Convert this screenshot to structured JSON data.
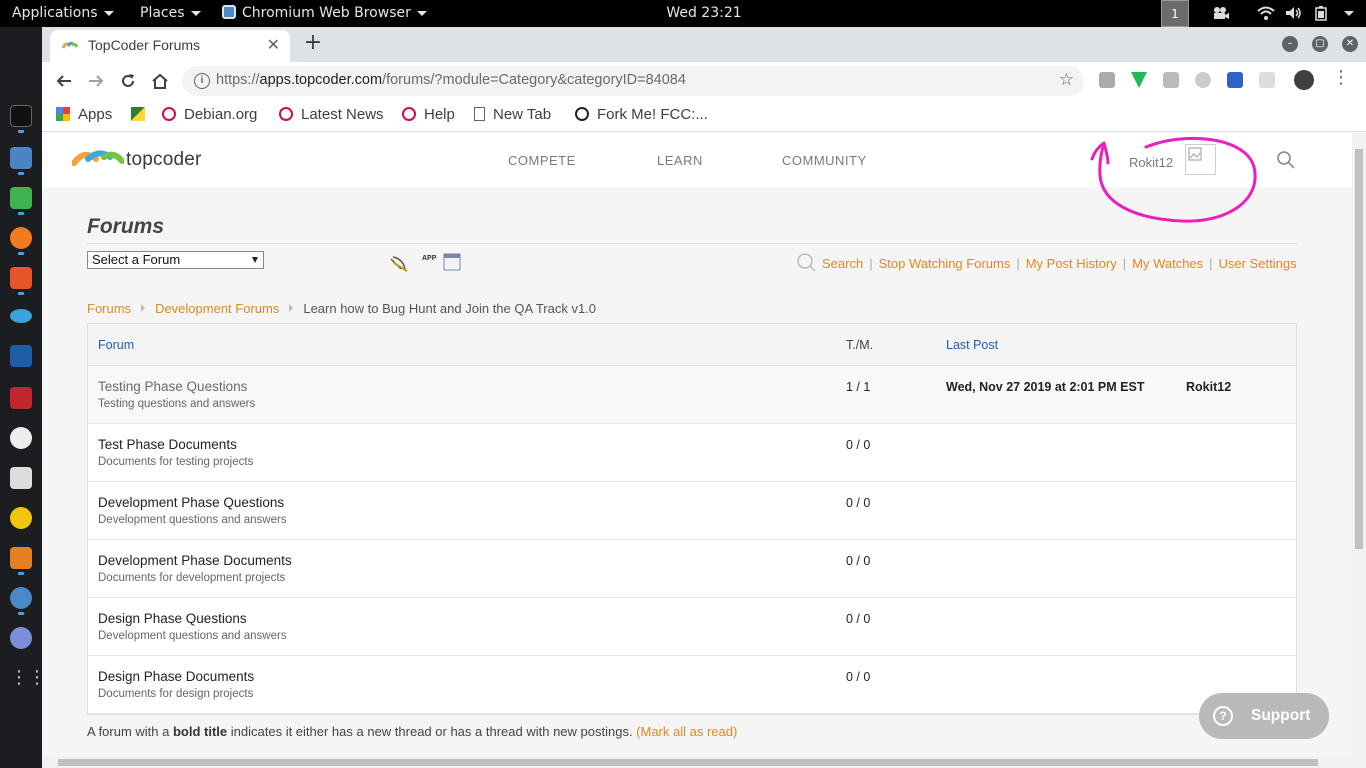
{
  "system": {
    "applications_label": "Applications",
    "places_label": "Places",
    "active_app_label": "Chromium Web Browser",
    "clock": "Wed 23:21",
    "workspace": "1"
  },
  "browser": {
    "tab_title": "TopCoder Forums",
    "url_scheme": "https://",
    "url_host": "apps.topcoder.com",
    "url_path": "/forums/?module=Category&categoryID=84084",
    "bookmarks": [
      "Apps",
      "",
      "Debian.org",
      "Latest News",
      "Help",
      "New Tab",
      "Fork Me! FCC:..."
    ]
  },
  "site": {
    "logo_text": "topcoder",
    "nav": [
      "COMPETE",
      "LEARN",
      "COMMUNITY"
    ],
    "username": "Rokit12"
  },
  "forums": {
    "page_title": "Forums",
    "select_label": "Select a Forum",
    "app_icon_text": "APP",
    "links": {
      "search": "Search",
      "stop_watching": "Stop Watching Forums",
      "post_history": "My Post History",
      "watches": "My Watches",
      "settings": "User Settings"
    },
    "breadcrumb": {
      "root": "Forums",
      "parent": "Development Forums",
      "current": "Learn how to Bug Hunt and Join the QA Track v1.0"
    },
    "table": {
      "headers": {
        "forum": "Forum",
        "tm": "T./M.",
        "last_post": "Last Post"
      },
      "rows": [
        {
          "name": "Testing Phase Questions",
          "desc": "Testing questions and answers",
          "tm": "1 / 1",
          "last_date": "Wed, Nov 27 2019 at 2:01 PM EST",
          "last_user": "Rokit12"
        },
        {
          "name": "Test Phase Documents",
          "desc": "Documents for testing projects",
          "tm": "0 / 0",
          "last_date": "",
          "last_user": ""
        },
        {
          "name": "Development Phase Questions",
          "desc": "Development questions and answers",
          "tm": "0 / 0",
          "last_date": "",
          "last_user": ""
        },
        {
          "name": "Development Phase Documents",
          "desc": "Documents for development projects",
          "tm": "0 / 0",
          "last_date": "",
          "last_user": ""
        },
        {
          "name": "Design Phase Questions",
          "desc": "Development questions and answers",
          "tm": "0 / 0",
          "last_date": "",
          "last_user": ""
        },
        {
          "name": "Design Phase Documents",
          "desc": "Documents for design projects",
          "tm": "0 / 0",
          "last_date": "",
          "last_user": ""
        }
      ]
    },
    "footnote": {
      "prefix": "A forum with a ",
      "bold": "bold title",
      "suffix": " indicates it either has a new thread or has a thread with new postings. ",
      "link": "(Mark all as read)"
    },
    "support_label": "Support"
  },
  "colors": {
    "accent_orange": "#e08a1e",
    "link_blue": "#1a5fb4",
    "annotation_magenta": "#ec1fbd"
  }
}
